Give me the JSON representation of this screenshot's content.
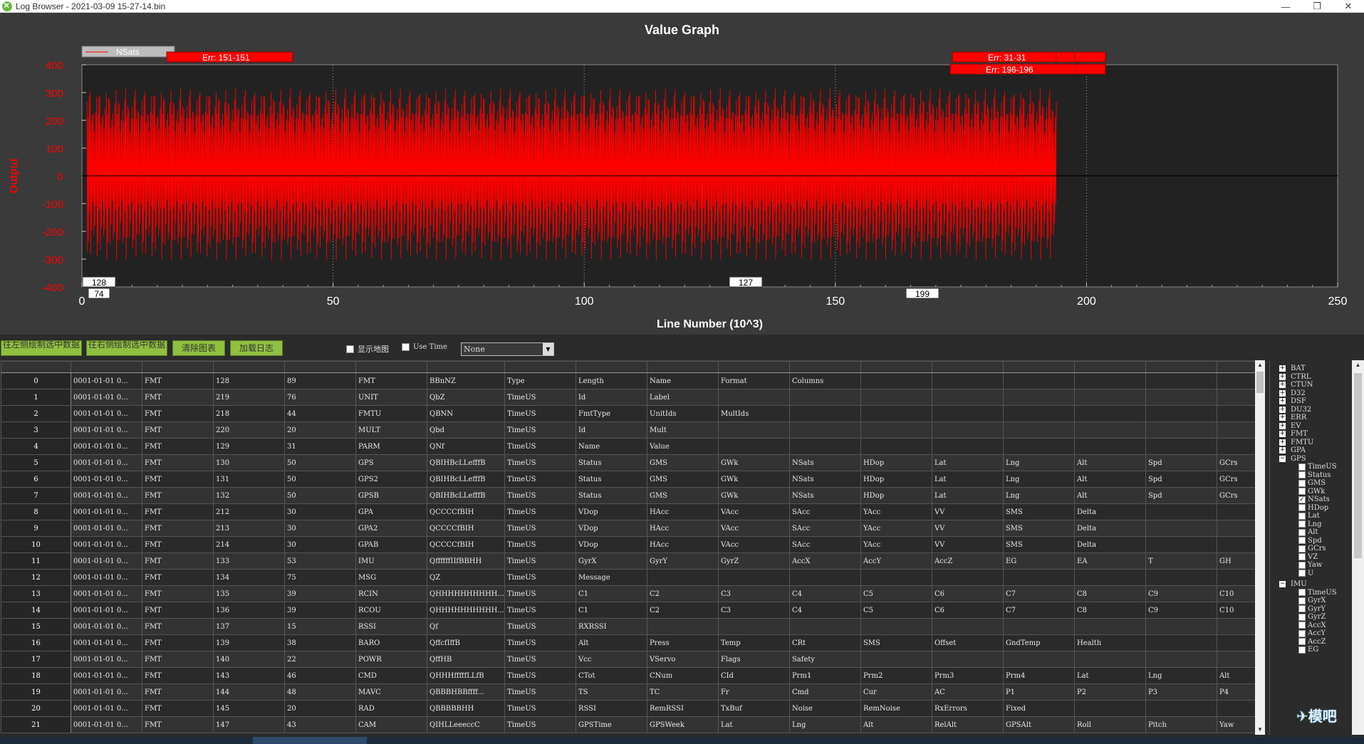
{
  "window": {
    "title": "Log Browser - 2021-03-09 15-27-14.bin",
    "minimize": "—",
    "restore": "❐",
    "close": "✕"
  },
  "graph": {
    "title": "Value Graph",
    "legend": "NSats",
    "badges": {
      "err1": "Err: 151-151",
      "err2": "Err: 31-31",
      "err3": "Err: 196-196",
      "b128": "128",
      "b74": "74",
      "b127": "127",
      "b199": "199"
    }
  },
  "chart_data": {
    "type": "line",
    "title": "Value Graph",
    "xlabel": "Line Number (10^3)",
    "ylabel": "Output",
    "xlim": [
      0,
      250
    ],
    "ylim": [
      -400,
      400
    ],
    "xticks": [
      "0",
      "50",
      "100",
      "150",
      "200",
      "250"
    ],
    "yticks": [
      "400",
      "300",
      "200",
      "100",
      "0",
      "-100",
      "-200",
      "-300",
      "-400"
    ],
    "series": [
      {
        "name": "NSats",
        "color": "#ff0000",
        "x_range": [
          1,
          194
        ],
        "amplitude_range": [
          -320,
          320
        ]
      }
    ],
    "grid": true,
    "legend_position": "top-left",
    "colors": {
      "background": "#222222",
      "axis_text": "#ff0000",
      "line": "#ff0000"
    }
  },
  "toolbar": {
    "btn_left": "往左侧绘制选中数据",
    "btn_right": "往右侧绘制选中数据",
    "btn_clear": "清除图表",
    "btn_load": "加载日志",
    "show_map": "显示地图",
    "use_time": "Use Time",
    "select_value": "None"
  },
  "table": {
    "rows": [
      [
        "0",
        "0001-01-01 0...",
        "FMT",
        "128",
        "89",
        "FMT",
        "BBnNZ",
        "Type",
        "Length",
        "Name",
        "Format",
        "Columns",
        "",
        "",
        "",
        "",
        "",
        ""
      ],
      [
        "1",
        "0001-01-01 0...",
        "FMT",
        "219",
        "76",
        "UNIT",
        "QbZ",
        "TimeUS",
        "Id",
        "Label",
        "",
        "",
        "",
        "",
        "",
        "",
        "",
        ""
      ],
      [
        "2",
        "0001-01-01 0...",
        "FMT",
        "218",
        "44",
        "FMTU",
        "QBNN",
        "TimeUS",
        "FmtType",
        "UnitIds",
        "MultIds",
        "",
        "",
        "",
        "",
        "",
        "",
        ""
      ],
      [
        "3",
        "0001-01-01 0...",
        "FMT",
        "220",
        "20",
        "MULT",
        "Qbd",
        "TimeUS",
        "Id",
        "Mult",
        "",
        "",
        "",
        "",
        "",
        "",
        "",
        ""
      ],
      [
        "4",
        "0001-01-01 0...",
        "FMT",
        "129",
        "31",
        "PARM",
        "QNf",
        "TimeUS",
        "Name",
        "Value",
        "",
        "",
        "",
        "",
        "",
        "",
        "",
        ""
      ],
      [
        "5",
        "0001-01-01 0...",
        "FMT",
        "130",
        "50",
        "GPS",
        "QBIHBcLLefffB",
        "TimeUS",
        "Status",
        "GMS",
        "GWk",
        "NSats",
        "HDop",
        "Lat",
        "Lng",
        "Alt",
        "Spd",
        "GCrs"
      ],
      [
        "6",
        "0001-01-01 0...",
        "FMT",
        "131",
        "50",
        "GPS2",
        "QBIHBcLLefffB",
        "TimeUS",
        "Status",
        "GMS",
        "GWk",
        "NSats",
        "HDop",
        "Lat",
        "Lng",
        "Alt",
        "Spd",
        "GCrs"
      ],
      [
        "7",
        "0001-01-01 0...",
        "FMT",
        "132",
        "50",
        "GPSB",
        "QBIHBcLLefffB",
        "TimeUS",
        "Status",
        "GMS",
        "GWk",
        "NSats",
        "HDop",
        "Lat",
        "Lng",
        "Alt",
        "Spd",
        "GCrs"
      ],
      [
        "8",
        "0001-01-01 0...",
        "FMT",
        "212",
        "30",
        "GPA",
        "QCCCCfBIH",
        "TimeUS",
        "VDop",
        "HAcc",
        "VAcc",
        "SAcc",
        "YAcc",
        "VV",
        "SMS",
        "Delta",
        "",
        ""
      ],
      [
        "9",
        "0001-01-01 0...",
        "FMT",
        "213",
        "30",
        "GPA2",
        "QCCCCfBIH",
        "TimeUS",
        "VDop",
        "HAcc",
        "VAcc",
        "SAcc",
        "YAcc",
        "VV",
        "SMS",
        "Delta",
        "",
        ""
      ],
      [
        "10",
        "0001-01-01 0...",
        "FMT",
        "214",
        "30",
        "GPAB",
        "QCCCCfBIH",
        "TimeUS",
        "VDop",
        "HAcc",
        "VAcc",
        "SAcc",
        "YAcc",
        "VV",
        "SMS",
        "Delta",
        "",
        ""
      ],
      [
        "11",
        "0001-01-01 0...",
        "FMT",
        "133",
        "53",
        "IMU",
        "QffffffIIfBBHH",
        "TimeUS",
        "GyrX",
        "GyrY",
        "GyrZ",
        "AccX",
        "AccY",
        "AccZ",
        "EG",
        "EA",
        "T",
        "GH"
      ],
      [
        "12",
        "0001-01-01 0...",
        "FMT",
        "134",
        "75",
        "MSG",
        "QZ",
        "TimeUS",
        "Message",
        "",
        "",
        "",
        "",
        "",
        "",
        "",
        "",
        ""
      ],
      [
        "13",
        "0001-01-01 0...",
        "FMT",
        "135",
        "39",
        "RCIN",
        "QHHHHHHHHHH...",
        "TimeUS",
        "C1",
        "C2",
        "C3",
        "C4",
        "C5",
        "C6",
        "C7",
        "C8",
        "C9",
        "C10"
      ],
      [
        "14",
        "0001-01-01 0...",
        "FMT",
        "136",
        "39",
        "RCOU",
        "QHHHHHHHHHH...",
        "TimeUS",
        "C1",
        "C2",
        "C3",
        "C4",
        "C5",
        "C6",
        "C7",
        "C8",
        "C9",
        "C10"
      ],
      [
        "15",
        "0001-01-01 0...",
        "FMT",
        "137",
        "15",
        "RSSI",
        "Qf",
        "TimeUS",
        "RXRSSI",
        "",
        "",
        "",
        "",
        "",
        "",
        "",
        "",
        ""
      ],
      [
        "16",
        "0001-01-01 0...",
        "FMT",
        "139",
        "38",
        "BARO",
        "QffcfIffB",
        "TimeUS",
        "Alt",
        "Press",
        "Temp",
        "CRt",
        "SMS",
        "Offset",
        "GndTemp",
        "Health",
        "",
        ""
      ],
      [
        "17",
        "0001-01-01 0...",
        "FMT",
        "140",
        "22",
        "POWR",
        "QffHB",
        "TimeUS",
        "Vcc",
        "VServo",
        "Flags",
        "Safety",
        "",
        "",
        "",
        "",
        "",
        ""
      ],
      [
        "18",
        "0001-01-01 0...",
        "FMT",
        "143",
        "46",
        "CMD",
        "QHHHfffffLLfB",
        "TimeUS",
        "CTot",
        "CNum",
        "CId",
        "Prm1",
        "Prm2",
        "Prm3",
        "Prm4",
        "Lat",
        "Lng",
        "Alt"
      ],
      [
        "19",
        "0001-01-01 0...",
        "FMT",
        "144",
        "48",
        "MAVC",
        "QBBBHBBffff...",
        "TimeUS",
        "TS",
        "TC",
        "Fr",
        "Cmd",
        "Cur",
        "AC",
        "P1",
        "P2",
        "P3",
        "P4"
      ],
      [
        "20",
        "0001-01-01 0...",
        "FMT",
        "145",
        "20",
        "RAD",
        "QBBBBBHH",
        "TimeUS",
        "RSSI",
        "RemRSSI",
        "TxBuf",
        "Noise",
        "RemNoise",
        "RxErrors",
        "Fixed",
        "",
        "",
        ""
      ],
      [
        "21",
        "0001-01-01 0...",
        "FMT",
        "147",
        "43",
        "CAM",
        "QIHLLeeeccC",
        "TimeUS",
        "GPSTime",
        "GPSWeek",
        "Lat",
        "Lng",
        "Alt",
        "RelAlt",
        "GPSAlt",
        "Roll",
        "Pitch",
        "Yaw"
      ]
    ]
  },
  "tree": {
    "top": [
      "BAT",
      "CTRL",
      "CTUN",
      "D32",
      "DSF",
      "DU32",
      "ERR",
      "EV",
      "FMT",
      "FMTU",
      "GPA"
    ],
    "gps_label": "GPS",
    "gps_children": [
      "TimeUS",
      "Status",
      "GMS",
      "GWk",
      "NSats",
      "HDop",
      "Lat",
      "Lng",
      "Alt",
      "Spd",
      "GCrs",
      "VZ",
      "Yaw",
      "U"
    ],
    "gps_checked": "NSats",
    "imu_label": "IMU",
    "imu_children": [
      "TimeUS",
      "GyrX",
      "GyrY",
      "GyrZ",
      "AccX",
      "AccY",
      "AccZ",
      "EG"
    ]
  },
  "watermark": "模吧"
}
